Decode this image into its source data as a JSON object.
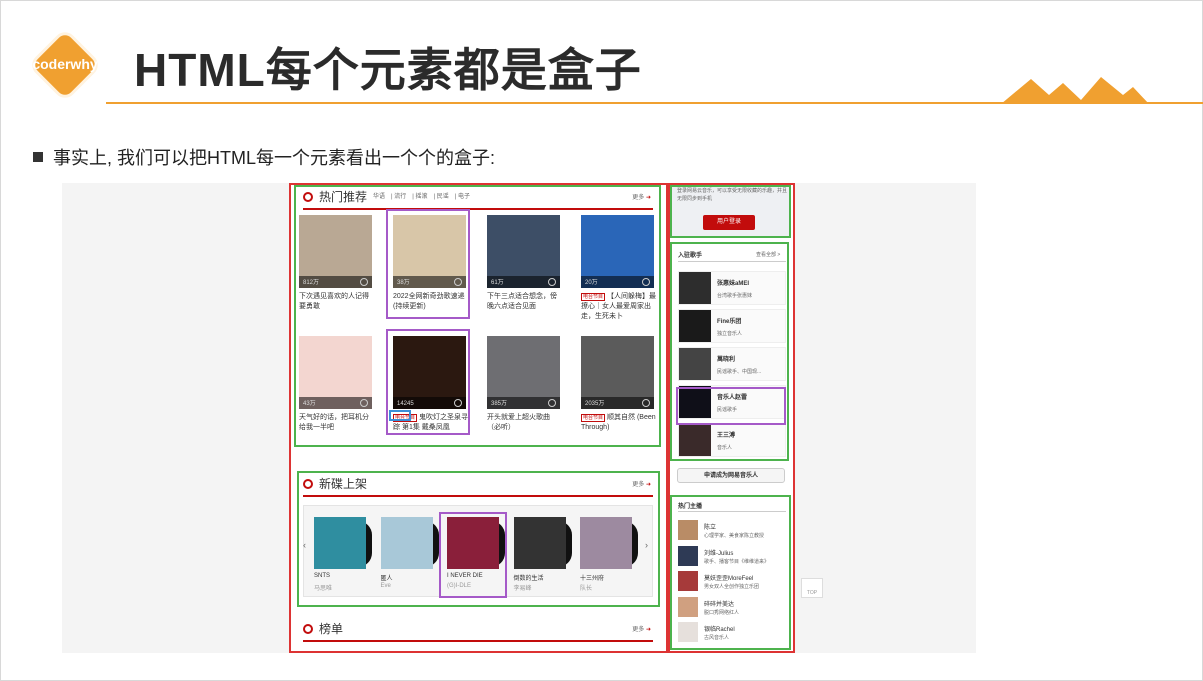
{
  "slide": {
    "logo_text": "coderwhy",
    "title": "HTML每个元素都是盒子",
    "bullet": "事实上, 我们可以把HTML每一个元素看出一个个的盒子:"
  },
  "hot": {
    "heading": "热门推荐",
    "tabs": [
      "华语",
      "流行",
      "摇滚",
      "民谣",
      "电子"
    ],
    "more": "更多",
    "cards": [
      {
        "count": "812万",
        "caption": "下次遇见喜欢的人记得要勇敢",
        "tag": "",
        "color": "#b9a894"
      },
      {
        "count": "38万",
        "caption": "2022全网新奇劲歌速递(持续更新)",
        "tag": "",
        "color": "#d8c6a8"
      },
      {
        "count": "61万",
        "caption": "下午三点适合想念，傍晚六点适合见面",
        "tag": "",
        "color": "#3d4e66"
      },
      {
        "count": "20万",
        "caption": "【人间躲梅】最撩心｜女人最爱周家出走，生死未卜",
        "tag": "电台节目",
        "color": "#2a66b8"
      },
      {
        "count": "43万",
        "caption": "天气好的话，把耳机分给我一半吧",
        "tag": "",
        "color": "#f3d6d0"
      },
      {
        "count": "14245",
        "caption": "鬼吹灯之圣泉寻踪 第1集 戴桑凤凰",
        "tag": "电台节目",
        "color": "#2b1810"
      },
      {
        "count": "385万",
        "caption": "开头就爱上超火歌曲（必听）",
        "tag": "",
        "color": "#6e6e72"
      },
      {
        "count": "2035万",
        "caption": "顺其自然 (Been Through)",
        "tag": "电台节目",
        "color": "#5b5b5b"
      }
    ]
  },
  "new_albums": {
    "heading": "新碟上架",
    "more": "更多",
    "albums": [
      {
        "title": "SNTS",
        "artist": "马思唯",
        "color": "#2f8ea0"
      },
      {
        "title": "匿人",
        "artist": "Eve",
        "color": "#a8c8d8"
      },
      {
        "title": "I NEVER DIE",
        "artist": "(G)I-DLE",
        "color": "#8a1f3a"
      },
      {
        "title": "倒数的生活",
        "artist": "李易峰",
        "color": "#333333"
      },
      {
        "title": "十三州府",
        "artist": "队长",
        "color": "#9d8aa0"
      }
    ]
  },
  "charts": {
    "heading": "榜单",
    "more": "更多"
  },
  "login": {
    "desc": "登录网易云音乐，可以享受无限收藏的乐趣，并且无限同步到手机",
    "button": "用户登录"
  },
  "singers": {
    "heading": "入驻歌手",
    "more": "查看全部 >",
    "items": [
      {
        "name": "张惠妹aMEI",
        "desc": "台湾歌手张惠妹",
        "color": "#2d2d2d"
      },
      {
        "name": "Fine乐团",
        "desc": "独立音乐人",
        "color": "#1a1a1a"
      },
      {
        "name": "萬晓利",
        "desc": "民谣歌手、中国现...",
        "color": "#444444"
      },
      {
        "name": "音乐人赵雷",
        "desc": "民谣歌手",
        "color": "#0f0f18"
      },
      {
        "name": "王三溥",
        "desc": "音乐人",
        "color": "#3a2a2a"
      }
    ],
    "apply": "申请成为网易音乐人"
  },
  "anchors": {
    "heading": "热门主播",
    "items": [
      {
        "name": "陈立",
        "desc": "心理学家、美食家陈立教授",
        "color": "#b98c66"
      },
      {
        "name": "刘维-Julius",
        "desc": "歌手、播客节目《维维道来》",
        "color": "#2e3a55"
      },
      {
        "name": "莫妖歪歪MoreFeel",
        "desc": "男女双人全创作独立乐团",
        "color": "#a63a3a"
      },
      {
        "name": "碎碎并美达",
        "desc": "脱口秀网络红人",
        "color": "#d0a080"
      },
      {
        "name": "银临Rachel",
        "desc": "古风音乐人",
        "color": "#e6e0dc"
      }
    ]
  },
  "top_button": "TOP"
}
